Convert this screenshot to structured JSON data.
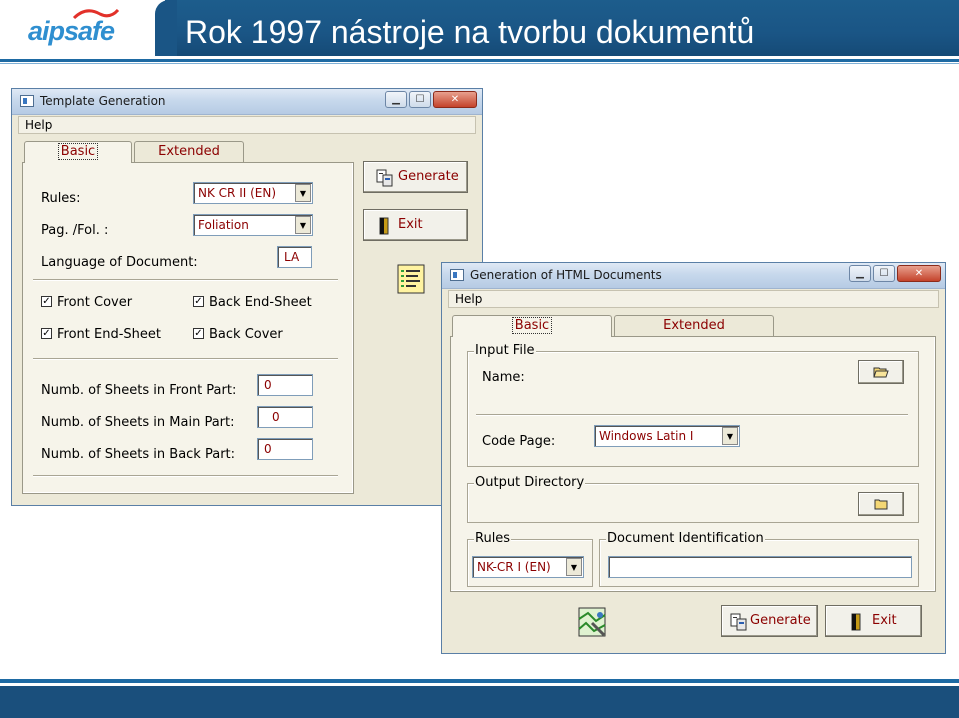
{
  "slide": {
    "logo_text": "aipsafe",
    "title": "Rok 1997 nástroje na tvorbu dokumentů"
  },
  "template_window": {
    "title": "Template Generation",
    "menu_help": "Help",
    "tabs": [
      "Basic",
      "Extended"
    ],
    "rules_label": "Rules:",
    "rules_value": "NK CR II (EN)",
    "pagfol_label": "Pag. /Fol. :",
    "pagfol_value": "Foliation",
    "language_label": "Language of Document:",
    "language_value": "LA",
    "checkboxes": [
      {
        "label": "Front Cover",
        "checked": true
      },
      {
        "label": "Back End-Sheet",
        "checked": true
      },
      {
        "label": "Front End-Sheet",
        "checked": true
      },
      {
        "label": "Back Cover",
        "checked": true
      }
    ],
    "front_part_label": "Numb. of Sheets in Front Part:",
    "front_part_value": "0",
    "main_part_label": "Numb. of Sheets in Main Part:",
    "main_part_value": "0",
    "back_part_label": "Numb. of Sheets in Back Part:",
    "back_part_value": "0",
    "generate_label": "Generate",
    "exit_label": "Exit"
  },
  "html_window": {
    "title": "Generation of HTML Documents",
    "menu_help": "Help",
    "tabs": [
      "Basic",
      "Extended"
    ],
    "input_file_group": "Input File",
    "name_label": "Name:",
    "code_page_label": "Code Page:",
    "code_page_value": "Windows Latin I",
    "output_dir_group": "Output Directory",
    "rules_group": "Rules",
    "rules_value": "NK-CR I (EN)",
    "doc_id_group": "Document Identification",
    "doc_id_value": "",
    "generate_label": "Generate",
    "exit_label": "Exit"
  },
  "colors": {
    "header_blue": "#1a5585",
    "label_red": "#8b0000",
    "window_face": "#ece9d8"
  }
}
